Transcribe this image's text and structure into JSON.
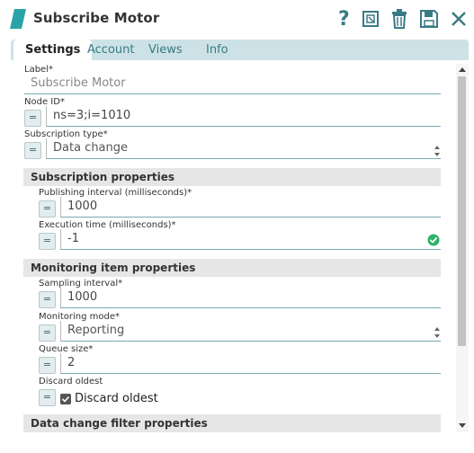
{
  "header": {
    "title": "Subscribe Motor",
    "icons": [
      "help-icon",
      "export-icon",
      "delete-icon",
      "save-icon",
      "close-icon"
    ]
  },
  "tabs": [
    {
      "label": "Settings",
      "active": true
    },
    {
      "label": "Account",
      "active": false
    },
    {
      "label": "Views",
      "active": false
    },
    {
      "label": "Info",
      "active": false
    }
  ],
  "form": {
    "label": {
      "title": "Label*",
      "value": "Subscribe Motor"
    },
    "node_id": {
      "title": "Node ID*",
      "value": "ns=3;i=1010",
      "expr_button": "="
    },
    "subscription_type": {
      "title": "Subscription type*",
      "value": "Data change",
      "expr_button": "="
    }
  },
  "subscription_properties": {
    "title": "Subscription properties",
    "publishing_interval": {
      "title": "Publishing interval (milliseconds)*",
      "value": "1000",
      "expr_button": "="
    },
    "execution_time": {
      "title": "Execution time (milliseconds)*",
      "value": "-1",
      "expr_button": "="
    }
  },
  "monitoring_item_properties": {
    "title": "Monitoring item properties",
    "sampling_interval": {
      "title": "Sampling interval*",
      "value": "1000",
      "expr_button": "="
    },
    "monitoring_mode": {
      "title": "Monitoring mode*",
      "value": "Reporting",
      "expr_button": "="
    },
    "queue_size": {
      "title": "Queue size*",
      "value": "2",
      "expr_button": "="
    },
    "discard_oldest": {
      "title": "Discard oldest",
      "checkbox_label": "Discard oldest",
      "checked": true,
      "expr_button": "="
    }
  },
  "data_change_filter": {
    "title": "Data change filter properties"
  },
  "colors": {
    "accent": "#2a9aa8",
    "valid": "#2db36b",
    "tab_bar": "#cce2e6"
  }
}
